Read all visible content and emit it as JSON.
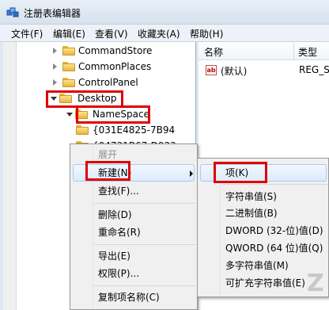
{
  "window": {
    "title": "注册表编辑器"
  },
  "menubar": {
    "items": [
      {
        "label": "文件(F)"
      },
      {
        "label": "编辑(E)"
      },
      {
        "label": "查看(V)"
      },
      {
        "label": "收藏夹(A)"
      },
      {
        "label": "帮助(H)"
      }
    ]
  },
  "tree": {
    "items": [
      {
        "label": "CommandStore",
        "expanded": false
      },
      {
        "label": "CommonPlaces",
        "expanded": false
      },
      {
        "label": "ControlPanel",
        "expanded": false
      },
      {
        "label": "Desktop",
        "expanded": true
      },
      {
        "label": "NameSpace",
        "expanded": true
      },
      {
        "label": "{031E4825-7B94",
        "expanded": false
      },
      {
        "label": "{04731B67-D933",
        "expanded": false
      }
    ]
  },
  "list": {
    "columns": {
      "name": "名称",
      "type": "类型"
    },
    "rows": [
      {
        "name": "(默认)",
        "type": "REG_S",
        "icon": "ab-string-icon"
      }
    ]
  },
  "context_menu": {
    "items": [
      {
        "label": "展开",
        "disabled": true
      },
      {
        "label": "新建(N)",
        "highlighted": true,
        "has_submenu": true
      },
      {
        "label": "查找(F)..."
      },
      {
        "label": "删除(D)"
      },
      {
        "label": "重命名(R)"
      },
      {
        "label": "导出(E)"
      },
      {
        "label": "权限(P)..."
      },
      {
        "label": "复制项名称(C)"
      }
    ]
  },
  "submenu": {
    "items": [
      {
        "label": "项(K)",
        "highlighted": true
      },
      {
        "label": "字符串值(S)"
      },
      {
        "label": "二进制值(B)"
      },
      {
        "label": "DWORD (32-位)值(D)"
      },
      {
        "label": "QWORD (64 位)值(Q)"
      },
      {
        "label": "多字符串值(M)"
      },
      {
        "label": "可扩充字符串值(E)"
      }
    ]
  },
  "colors": {
    "highlight_box": "#e00000",
    "folder": "#e8b640",
    "menu_bg": "#f0f0f0"
  }
}
